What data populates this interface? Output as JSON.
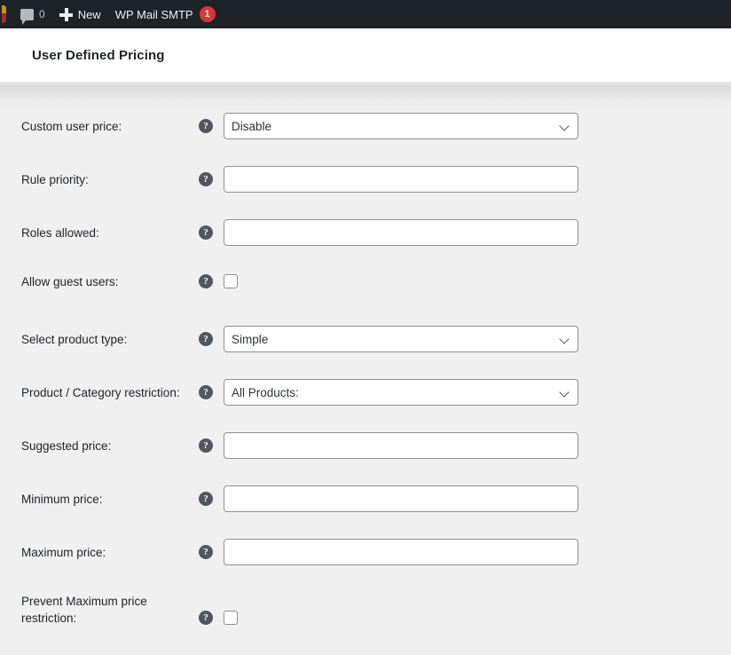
{
  "adminbar": {
    "wp_logo_icon": "wordpress-logo-icon",
    "comments": {
      "icon": "comment-bubble-icon",
      "count": "0"
    },
    "new": {
      "icon": "plus-icon",
      "label": "New"
    },
    "smtp": {
      "label": "WP Mail SMTP",
      "badge": "1",
      "badge_color": "#d63638"
    },
    "bar_color": "#1d2327",
    "text_color": "#f0f0f1"
  },
  "header": {
    "title": "User Defined Pricing"
  },
  "form": {
    "help_icon": "help-question-icon",
    "rows": [
      {
        "label": "Custom user price:",
        "type": "select",
        "value": "Disable",
        "name": "custom-user-price"
      },
      {
        "label": "Rule priority:",
        "type": "text",
        "value": "",
        "name": "rule-priority"
      },
      {
        "label": "Roles allowed:",
        "type": "text",
        "value": "",
        "name": "roles-allowed"
      },
      {
        "label": "Allow guest users:",
        "type": "checkbox",
        "checked": false,
        "name": "allow-guest-users"
      },
      {
        "label": "Select product type:",
        "type": "select",
        "value": "Simple",
        "name": "select-product-type"
      },
      {
        "label": "Product / Category restriction:",
        "type": "select",
        "value": "All Products:",
        "name": "product-category-restriction"
      },
      {
        "label": "Suggested price:",
        "type": "text",
        "value": "",
        "name": "suggested-price"
      },
      {
        "label": "Minimum price:",
        "type": "text",
        "value": "",
        "name": "minimum-price"
      },
      {
        "label": "Maximum price:",
        "type": "text",
        "value": "",
        "name": "maximum-price"
      },
      {
        "label": "Prevent Maximum price restriction:",
        "type": "checkbox",
        "checked": false,
        "name": "prevent-maximum-price-restriction"
      }
    ]
  }
}
